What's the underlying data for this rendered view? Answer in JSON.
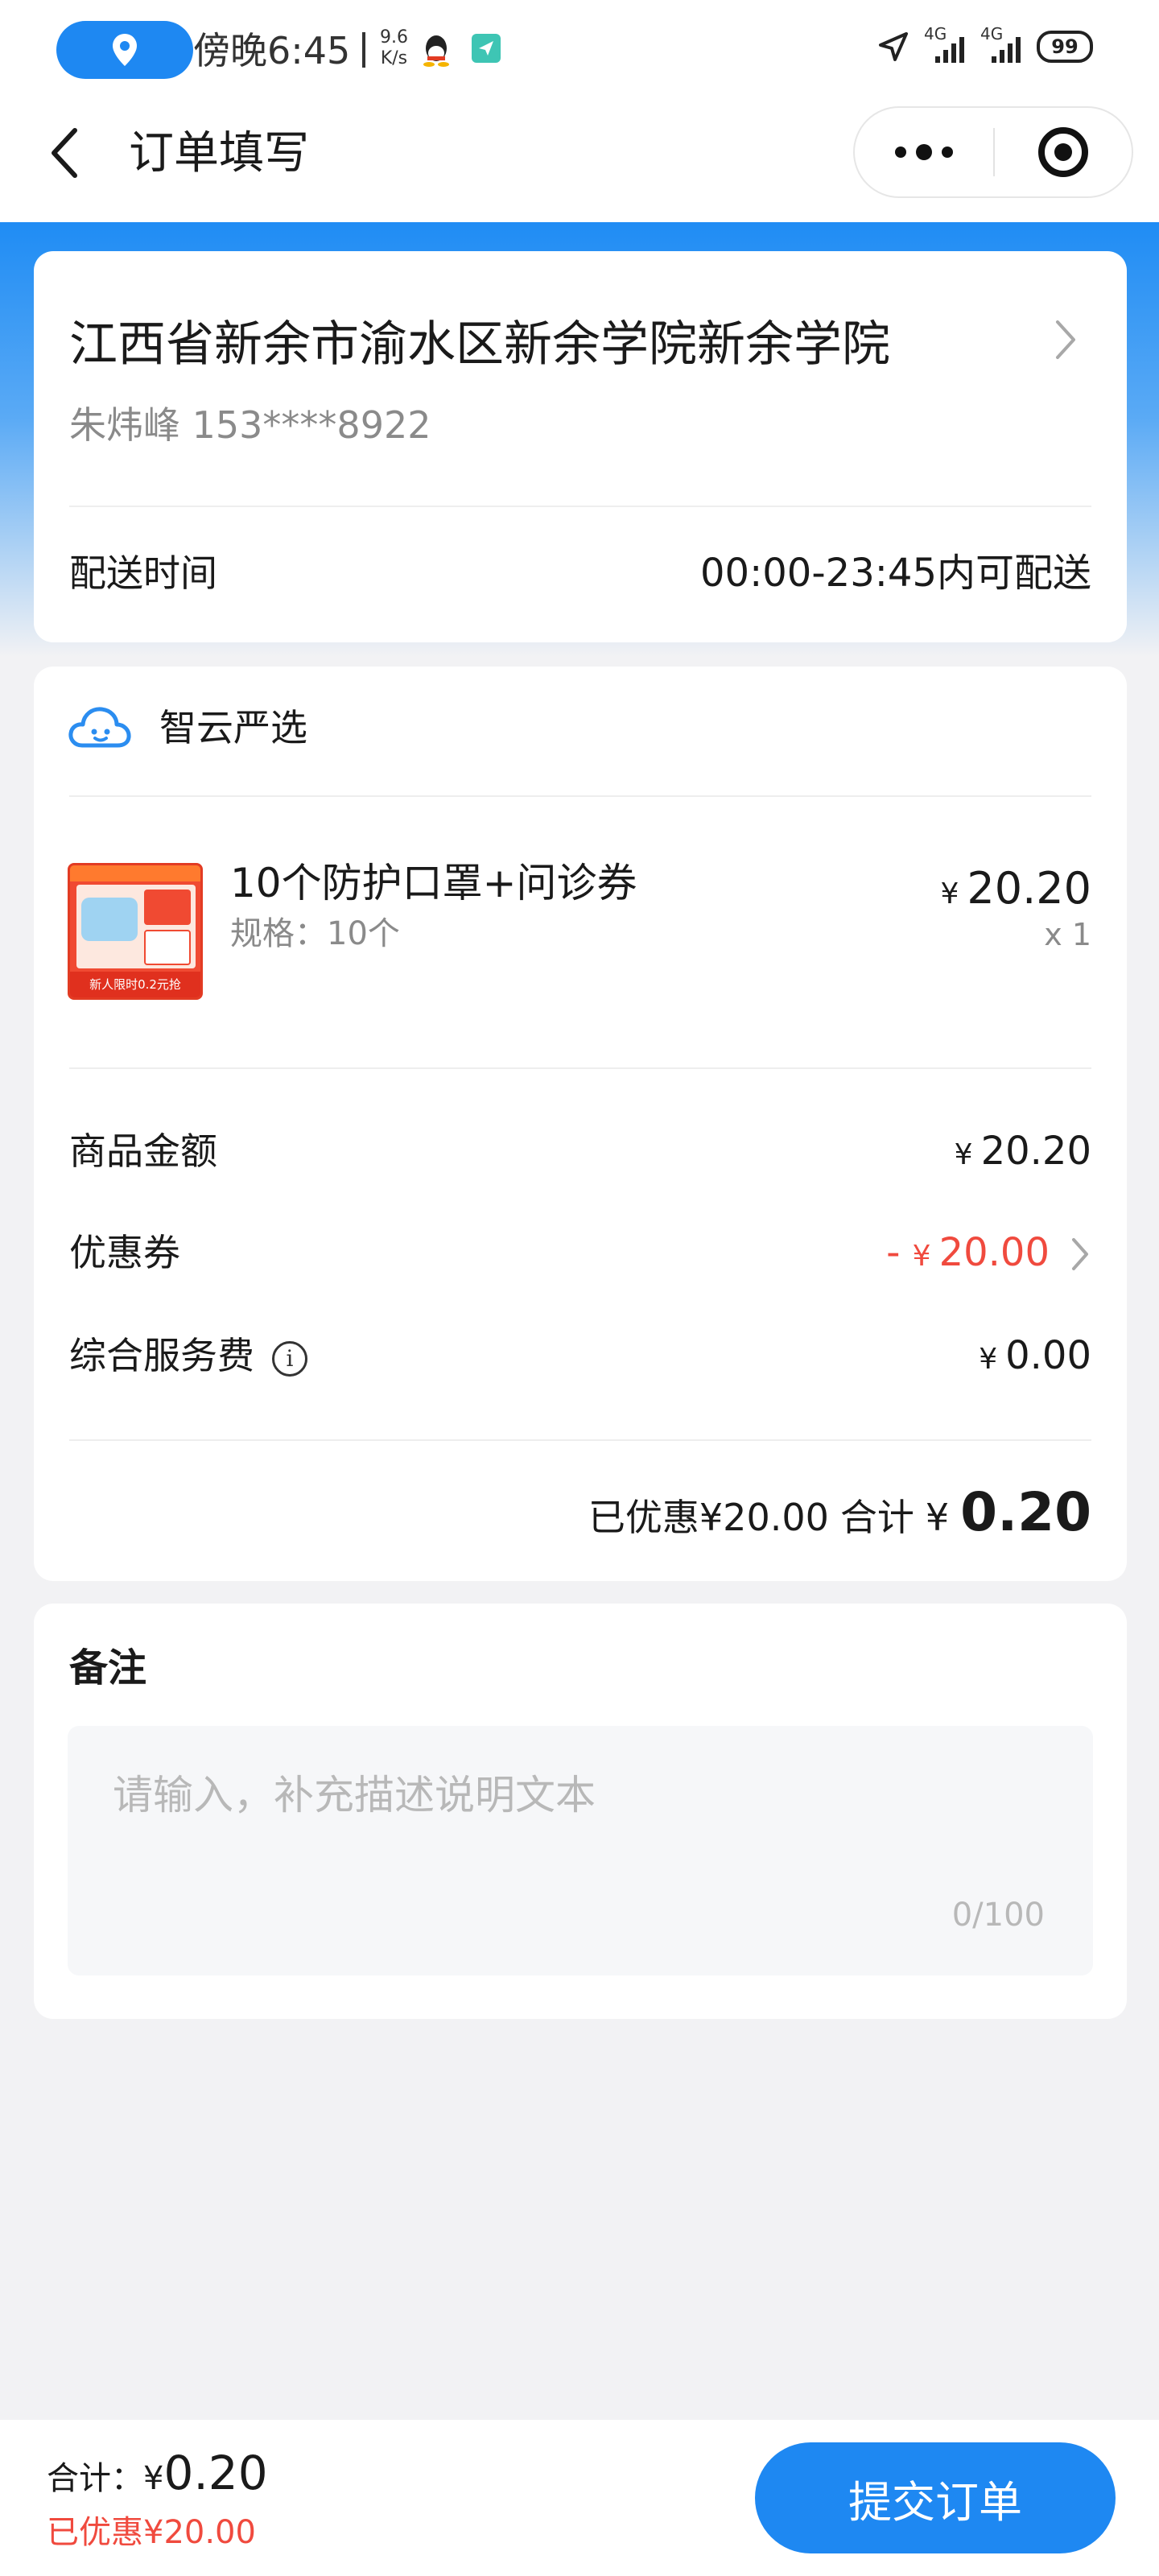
{
  "status_bar": {
    "time": "傍晚6:45",
    "speed_value": "9.6",
    "speed_unit": "K/s",
    "net1": "4G",
    "net2": "4G",
    "battery": "99"
  },
  "nav": {
    "title": "订单填写"
  },
  "address": {
    "line": "江西省新余市渝水区新余学院新余学院",
    "person": "朱炜峰 153****8922",
    "delivery_label": "配送时间",
    "delivery_value": "00:00-23:45内可配送"
  },
  "shop": {
    "name": "智云严选"
  },
  "product": {
    "name": "10个防护口罩+问诊券",
    "spec": "规格：10个",
    "price_symbol": "¥",
    "price": "20.20",
    "qty": "x 1",
    "image_banner": "新人限时0.2元抢"
  },
  "summary": {
    "goods_label": "商品金额",
    "goods_symbol": "¥",
    "goods_value": "20.20",
    "coupon_label": "优惠券",
    "coupon_prefix": "- ",
    "coupon_symbol": "¥",
    "coupon_value": "20.00",
    "service_label": "综合服务费",
    "service_symbol": "¥",
    "service_value": "0.00",
    "discount_text": "已优惠¥20.00",
    "total_label": "合计",
    "total_symbol": "¥",
    "total_value": "0.20"
  },
  "remark": {
    "title": "备注",
    "placeholder": "请输入，补充描述说明文本",
    "count": "0/100"
  },
  "bottom": {
    "total_label": "合计：¥",
    "total_value": "0.20",
    "discount": "已优惠¥20.00",
    "submit_label": "提交订单"
  },
  "colors": {
    "accent": "#1e88f2",
    "discount": "#f04a3e"
  }
}
